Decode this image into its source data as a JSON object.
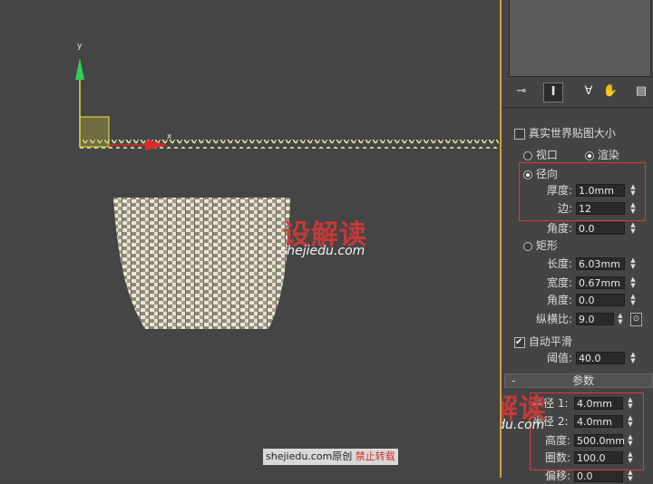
{
  "viewport": {
    "axis_y_label": "y",
    "axis_x_label": "x"
  },
  "watermarks": {
    "brand": "设解读",
    "domain": "shejiedu.com",
    "credit_site": "shejiedu.com原创",
    "credit_warning": "禁止转载"
  },
  "rendering": {
    "real_world_map_size": "真实世界贴图大小",
    "viewport_label": "视口",
    "render_label": "渲染",
    "radial_label": "径向",
    "thickness_label": "厚度:",
    "thickness_value": "1.0mm",
    "sides_label": "边:",
    "sides_value": "12",
    "angle_label": "角度:",
    "angle_value": "0.0",
    "rectangular_label": "矩形",
    "length_label": "长度:",
    "length_value": "6.03mm",
    "width_label": "宽度:",
    "width_value": "0.67mm",
    "rect_angle_label": "角度:",
    "rect_angle_value": "0.0",
    "aspect_label": "纵横比:",
    "aspect_value": "9.0",
    "auto_smooth_label": "自动平滑",
    "threshold_label": "阈值:",
    "threshold_value": "40.0"
  },
  "parameters": {
    "rollout_minus": "-",
    "rollout_title": "参数",
    "radius1_label": "半径 1:",
    "radius1_value": "4.0mm",
    "radius2_label": "半径 2:",
    "radius2_value": "4.0mm",
    "height_label": "高度:",
    "height_value": "500.0mm",
    "turns_label": "圈数:",
    "turns_value": "100.0",
    "bias_label": "偏移:",
    "bias_value": "0.0"
  },
  "colors": {
    "highlight_box": "#d63a3a",
    "viewport_border": "#c8a23a",
    "axis_y": "#2fd05a",
    "axis_x": "#d62b2b",
    "spring": "#e8e6a8",
    "gizmo": "#d8d040"
  },
  "icons": [
    "pin-icon",
    "modify-stack-icon",
    "funnel-icon",
    "hand-icon",
    "configure-icon"
  ]
}
